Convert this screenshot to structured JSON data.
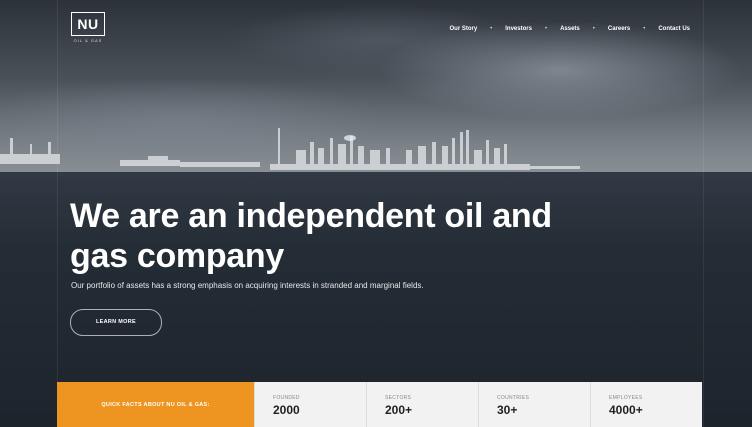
{
  "brand": {
    "logo_text": "NU",
    "logo_sub": "OIL & GAS"
  },
  "nav": {
    "items": [
      "Our Story",
      "Investors",
      "Assets",
      "Careers",
      "Contact Us"
    ],
    "separator": "•"
  },
  "hero": {
    "title": "We are an independent oil and gas company",
    "subtitle": "Our portfolio of assets has a strong emphasis on acquiring interests in stranded and marginal fields.",
    "cta_label": "LEARN MORE"
  },
  "facts": {
    "label": "QUICK FACTS ABOUT NU OIL & GAS:",
    "items": [
      {
        "label": "FOUNDED",
        "value": "2000"
      },
      {
        "label": "SECTORS",
        "value": "200+"
      },
      {
        "label": "COUNTRIES",
        "value": "30+"
      },
      {
        "label": "EMPLOYEES",
        "value": "4000+"
      }
    ]
  },
  "colors": {
    "accent": "#ee9521",
    "facts_bg": "#f2f2f2",
    "sea": "#1d242c"
  }
}
